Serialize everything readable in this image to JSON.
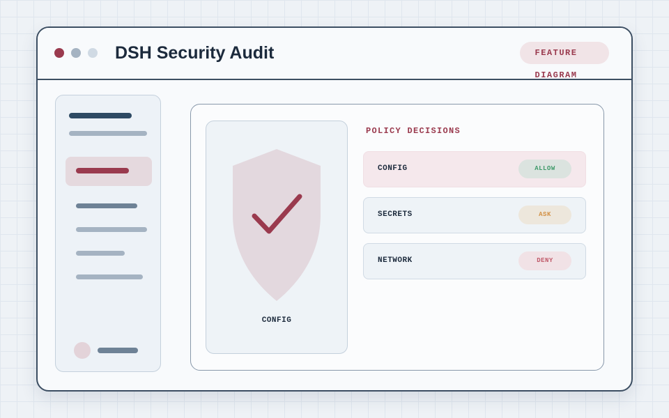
{
  "window": {
    "title": "DSH Security Audit",
    "badge": "FEATURE DIAGRAM"
  },
  "shield_card": {
    "label": "CONFIG",
    "icon": "shield-check-icon"
  },
  "policy": {
    "title": "POLICY DECISIONS",
    "rows": [
      {
        "label": "CONFIG",
        "decision": "ALLOW",
        "color": "#3f9a6a"
      },
      {
        "label": "SECRETS",
        "decision": "ASK",
        "color": "#d29044"
      },
      {
        "label": "NETWORK",
        "decision": "DENY",
        "color": "#c05a6a"
      }
    ]
  },
  "colors": {
    "accent": "#9a3a4e",
    "frame": "#3c4e62",
    "allow": "#3f9a6a",
    "ask": "#d29044",
    "deny": "#c05a6a"
  }
}
